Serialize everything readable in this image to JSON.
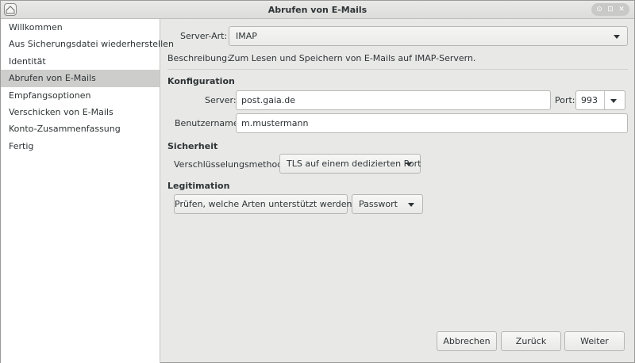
{
  "window": {
    "title": "Abrufen von E-Mails"
  },
  "sidebar": {
    "items": [
      {
        "label": "Willkommen"
      },
      {
        "label": "Aus Sicherungsdatei wiederherstellen"
      },
      {
        "label": "Identität"
      },
      {
        "label": "Abrufen von E-Mails",
        "selected": true
      },
      {
        "label": "Empfangsoptionen"
      },
      {
        "label": "Verschicken von E-Mails"
      },
      {
        "label": "Konto-Zusammenfassung"
      },
      {
        "label": "Fertig"
      }
    ]
  },
  "server_type": {
    "label": "Server-Art:",
    "value": "IMAP"
  },
  "description": {
    "label": "Beschreibung:",
    "text": "Zum Lesen und Speichern von E-Mails auf IMAP-Servern."
  },
  "configuration": {
    "heading": "Konfiguration",
    "server_label": "Server:",
    "server_value": "post.gaia.de",
    "port_label": "Port:",
    "port_value": "993",
    "username_label": "Benutzername:",
    "username_value": "m.mustermann"
  },
  "security": {
    "heading": "Sicherheit",
    "method_label": "Verschlüsselungsmethode:",
    "method_value": "TLS auf einem dedizierten Port"
  },
  "authentication": {
    "heading": "Legitimation",
    "check_button": "Prüfen, welche Arten unterstützt werden",
    "type_value": "Passwort"
  },
  "footer": {
    "cancel": "Abbrechen",
    "back": "Zurück",
    "next": "Weiter"
  }
}
